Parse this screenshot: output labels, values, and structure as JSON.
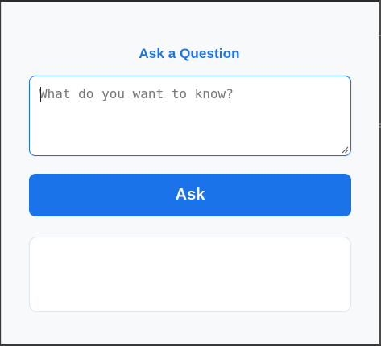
{
  "panel": {
    "title": "Ask a Question"
  },
  "question": {
    "placeholder": "What do you want to know?",
    "value": ""
  },
  "ask_button": {
    "label": "Ask"
  },
  "answer": {
    "text": ""
  },
  "colors": {
    "accent": "#1a73e8",
    "panel_background": "#f8f9fb",
    "button_text": "#ffffff"
  },
  "icons": {
    "textarea_resize": "resize-grip-icon"
  }
}
